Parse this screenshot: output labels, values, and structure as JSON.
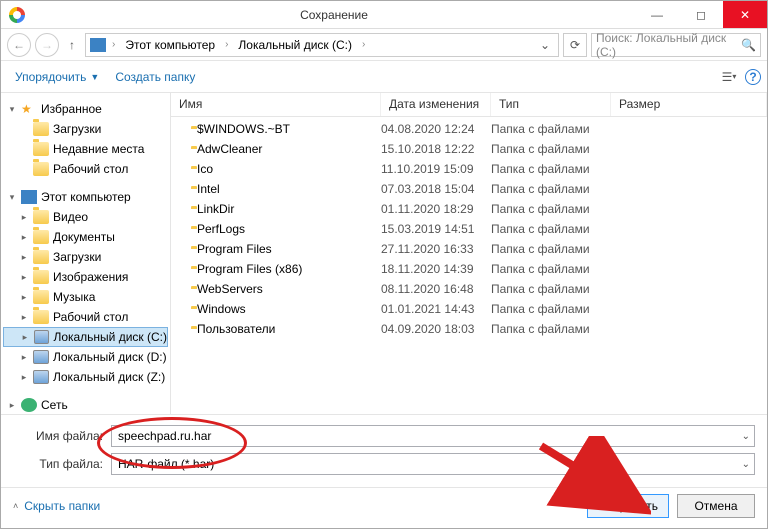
{
  "title": "Сохранение",
  "breadcrumb": {
    "root": "Этот компьютер",
    "loc": "Локальный диск (C:)"
  },
  "search_placeholder": "Поиск: Локальный диск (C:)",
  "toolbar": {
    "organize": "Упорядочить",
    "newfolder": "Создать папку"
  },
  "tree": {
    "fav": "Избранное",
    "fav_items": [
      "Загрузки",
      "Недавние места",
      "Рабочий стол"
    ],
    "pc": "Этот компьютер",
    "pc_items": [
      "Видео",
      "Документы",
      "Загрузки",
      "Изображения",
      "Музыка",
      "Рабочий стол",
      "Локальный диск (C:)",
      "Локальный диск (D:)",
      "Локальный диск (Z:)"
    ],
    "net": "Сеть"
  },
  "columns": {
    "name": "Имя",
    "date": "Дата изменения",
    "type": "Тип",
    "size": "Размер"
  },
  "rows": [
    {
      "name": "$WINDOWS.~BT",
      "date": "04.08.2020 12:24",
      "type": "Папка с файлами"
    },
    {
      "name": "AdwCleaner",
      "date": "15.10.2018 12:22",
      "type": "Папка с файлами"
    },
    {
      "name": "Ico",
      "date": "11.10.2019 15:09",
      "type": "Папка с файлами"
    },
    {
      "name": "Intel",
      "date": "07.03.2018 15:04",
      "type": "Папка с файлами"
    },
    {
      "name": "LinkDir",
      "date": "01.11.2020 18:29",
      "type": "Папка с файлами"
    },
    {
      "name": "PerfLogs",
      "date": "15.03.2019 14:51",
      "type": "Папка с файлами"
    },
    {
      "name": "Program Files",
      "date": "27.11.2020 16:33",
      "type": "Папка с файлами"
    },
    {
      "name": "Program Files (x86)",
      "date": "18.11.2020 14:39",
      "type": "Папка с файлами"
    },
    {
      "name": "WebServers",
      "date": "08.11.2020 16:48",
      "type": "Папка с файлами"
    },
    {
      "name": "Windows",
      "date": "01.01.2021 14:43",
      "type": "Папка с файлами"
    },
    {
      "name": "Пользователи",
      "date": "04.09.2020 18:03",
      "type": "Папка с файлами"
    }
  ],
  "filename_label": "Имя файла:",
  "filetype_label": "Тип файла:",
  "filename": "speechpad.ru.har",
  "filetype": "HAR-файл (*.har)",
  "hide_folders": "Скрыть папки",
  "save": "Сохранить",
  "cancel": "Отмена"
}
